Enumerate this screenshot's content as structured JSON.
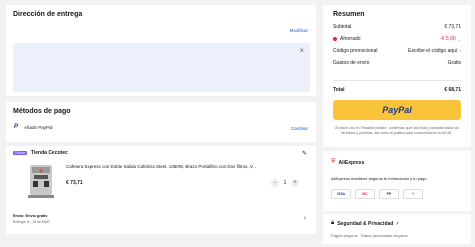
{
  "address": {
    "title": "Dirección de entrega",
    "modify_label": "Modificar",
    "close_glyph": "×"
  },
  "payment": {
    "title": "Métodos de pago",
    "add_paypal_label": "Añadir PayPal",
    "change_label": "Cambiar",
    "icon": "paypal-icon"
  },
  "store": {
    "badge": "Choice",
    "name": "Tienda Cecotec",
    "product_title": "Cafetera Express con Doble Salida Cafetizia Steel. 1350W, Brazo Portafiltro con Dos filtros, V...",
    "price": "€ 73,71",
    "quantity": "1",
    "minus": "-",
    "plus": "+",
    "shipping_line1": "Envío: Envío gratis",
    "shipping_line2": "Entrega: 6 - 16 de MAR"
  },
  "summary": {
    "title": "Resumen",
    "subtotal_label": "Subtotal",
    "subtotal_value": "€ 73,71",
    "saved_label": "Ahorrado",
    "saved_value": "-€ 5,00",
    "promo_label": "Código promocional",
    "promo_value": "Escribe el código aquí",
    "shipping_label": "Gastos de envío",
    "shipping_value": "Gratis",
    "total_label": "Total",
    "total_value": "€ 68,71",
    "paypal_button": "PayPal",
    "legal_text": "Al hacer clic en 'Realizar pedido', confirmas que has leído y aceptas todos los términos y políticas, así como la política para consumidores en la UE."
  },
  "trust": {
    "title": "AliExpress",
    "text": "AliExpress mantiene seguros tu información y tu pago",
    "payment_icons": [
      "VISA",
      "MC",
      "PP",
      "+"
    ]
  },
  "security": {
    "title": "Seguridad & Privacidad",
    "text": "Pagos seguros   Datos personales seguros"
  },
  "colors": {
    "accent": "#1a5dd6",
    "saved_red": "#e0282e",
    "paypal_yellow": "#f9c43a",
    "choice_badge": "#7a5af5"
  }
}
